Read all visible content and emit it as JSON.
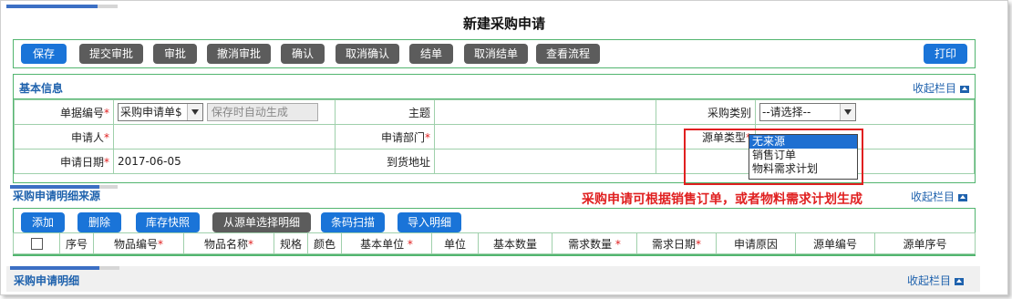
{
  "page_title": "新建采购申请",
  "toolbar": {
    "buttons": [
      "保存",
      "提交审批",
      "审批",
      "撤消审批",
      "确认",
      "取消确认",
      "结单",
      "取消结单",
      "查看流程"
    ],
    "print": "打印"
  },
  "basic": {
    "section_title": "基本信息",
    "collapse_label": "收起栏目",
    "doc_no_label": "单据编号",
    "doc_no_select": "采购申请单$",
    "doc_no_auto": "保存时自动生成",
    "subject_label": "主题",
    "purchase_type_label": "采购类别",
    "purchase_type_value": "--请选择--",
    "applicant_label": "申请人",
    "dept_label": "申请部门",
    "source_type_label": "源单类型",
    "date_label": "申请日期",
    "date_value": "2017-06-05",
    "address_label": "到货地址",
    "required_mark": "*"
  },
  "source_dropdown": {
    "options": [
      "无来源",
      "销售订单",
      "物料需求计划"
    ],
    "selected_index": 0
  },
  "annotation": "采购申请可根据销售订单，或者物料需求计划生成",
  "detail_source": {
    "section_title": "采购申请明细来源",
    "collapse_label": "收起栏目",
    "buttons": [
      "添加",
      "删除",
      "库存快照",
      "从源单选择明细",
      "条码扫描",
      "导入明细"
    ],
    "columns": [
      "序号",
      "物品编号",
      "物品名称",
      "规格",
      "颜色",
      "基本单位",
      "单位",
      "基本数量",
      "需求数量",
      "需求日期",
      "申请原因",
      "源单编号",
      "源单序号"
    ],
    "required_columns": [
      "物品编号",
      "物品名称",
      "基本单位",
      "需求数量",
      "需求日期"
    ]
  },
  "detail": {
    "section_title": "采购申请明细",
    "collapse_label": "收起栏目"
  },
  "colors": {
    "accent_blue": "#1a74d8",
    "dark_button": "#5c5c5c",
    "border_green": "#52b56f",
    "required_red": "#e02020",
    "section_title": "#1f62ad"
  }
}
